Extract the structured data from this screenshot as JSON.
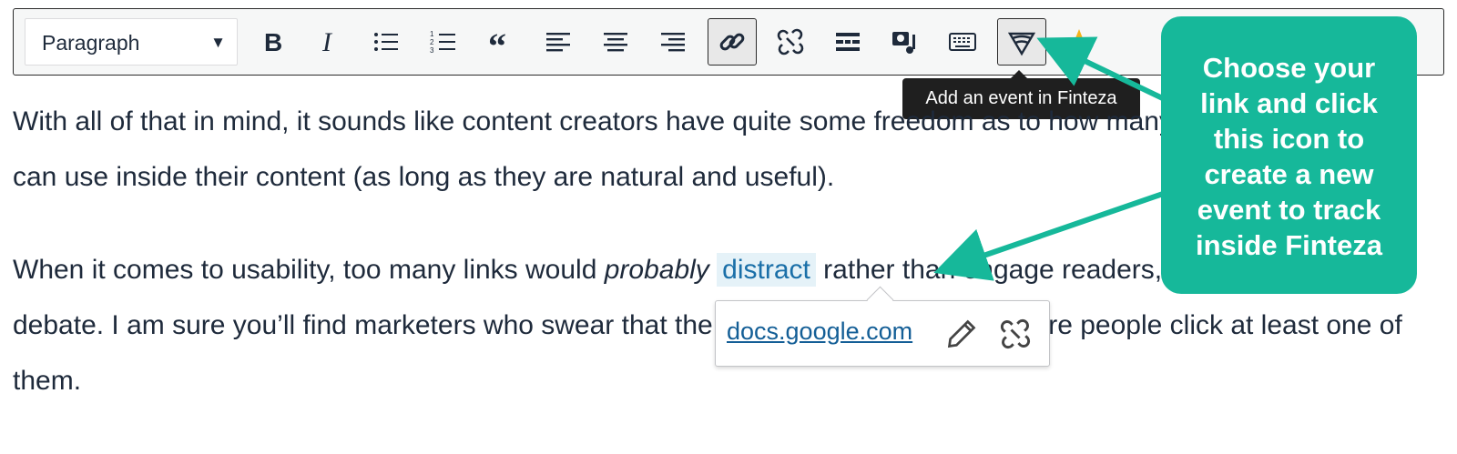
{
  "toolbar": {
    "format_select": {
      "value": "Paragraph",
      "arrow": "▼"
    },
    "buttons": [
      {
        "name": "bold-button",
        "icon": "bold-icon",
        "glyph": "B"
      },
      {
        "name": "italic-button",
        "icon": "italic-icon",
        "glyph": "I"
      },
      {
        "name": "bulleted-list-button",
        "icon": "bulleted-list-icon"
      },
      {
        "name": "numbered-list-button",
        "icon": "numbered-list-icon"
      },
      {
        "name": "blockquote-button",
        "icon": "blockquote-icon",
        "glyph": "“"
      },
      {
        "name": "align-left-button",
        "icon": "align-left-icon"
      },
      {
        "name": "align-center-button",
        "icon": "align-center-icon"
      },
      {
        "name": "align-right-button",
        "icon": "align-right-icon"
      },
      {
        "name": "insert-link-button",
        "icon": "link-icon",
        "active": true
      },
      {
        "name": "remove-link-button",
        "icon": "unlink-icon"
      },
      {
        "name": "read-more-button",
        "icon": "read-more-icon"
      },
      {
        "name": "add-media-button",
        "icon": "media-icon"
      },
      {
        "name": "keyboard-button",
        "icon": "keyboard-icon"
      },
      {
        "name": "finteza-event-button",
        "icon": "finteza-icon"
      },
      {
        "name": "favorite-button",
        "icon": "star-icon",
        "color": "#f5b21b"
      }
    ],
    "tooltip": "Add an event in Finteza"
  },
  "content": {
    "p1": "With all of that in mind, it sounds like content creators have quite some freedom as to how many internal links they can use inside their content (as long as they are natural and useful).",
    "p2_before": "When it comes to usability, too many links would ",
    "p2_em": "probably",
    "p2_link": "distract",
    "p2_after": " rather than engage readers, but it is up to a debate. I am sure you’ll find marketers who swear that the more links you add, the more people click at least one of them."
  },
  "link_popup": {
    "url": "docs.google.com",
    "edit_icon": "pencil-icon",
    "unlink_icon": "unlink-icon"
  },
  "callout": {
    "lines": [
      "Choose your",
      "link and click",
      "this icon to",
      "create a new",
      "event to track",
      "inside Finteza"
    ],
    "color": "#16b89a"
  }
}
